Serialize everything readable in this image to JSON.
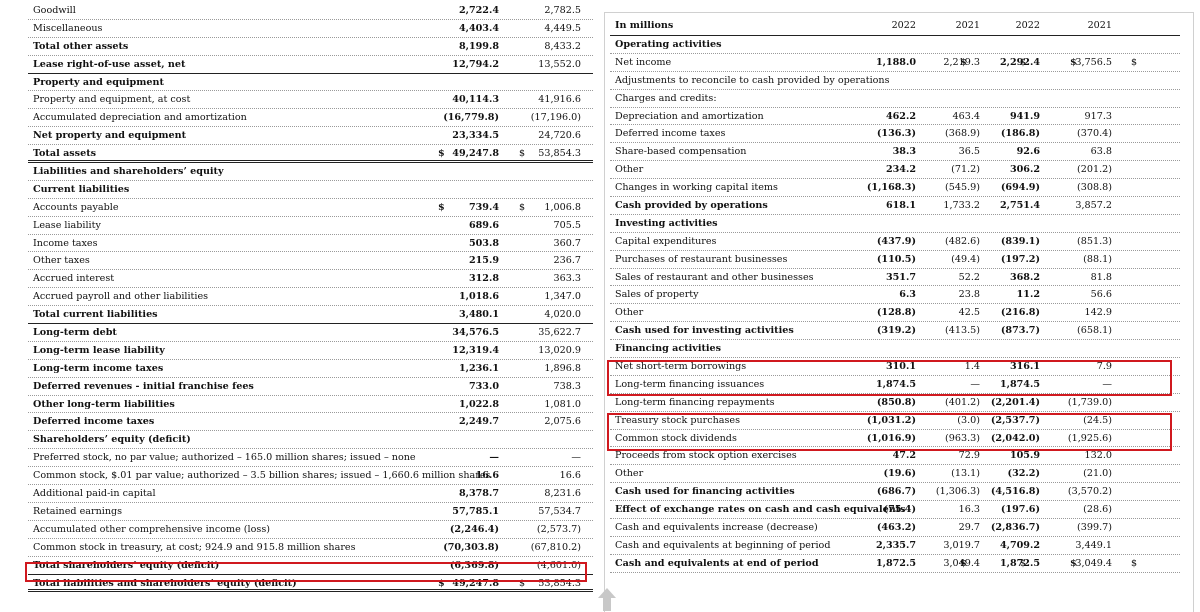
{
  "balance_sheet": {
    "rows": [
      {
        "label": "Goodwill",
        "v1": "2,722.4",
        "v2": "2,782.5",
        "style": "dotted"
      },
      {
        "label": "Miscellaneous",
        "v1": "4,403.4",
        "v2": "4,449.5",
        "style": "dotted"
      },
      {
        "label": "Total other assets",
        "v1": "8,199.8",
        "v2": "8,433.2",
        "style": "dotted",
        "bold": true
      },
      {
        "label": "Lease right-of-use asset, net",
        "v1": "12,794.2",
        "v2": "13,552.0",
        "style": "solid",
        "bold": true
      },
      {
        "label": "Property and equipment",
        "v1": "",
        "v2": "",
        "style": "dotted",
        "bold": true
      },
      {
        "label": "Property and equipment, at cost",
        "v1": "40,114.3",
        "v2": "41,916.6",
        "style": "dotted"
      },
      {
        "label": "Accumulated depreciation and amortization",
        "v1": "(16,779.8)",
        "v2": "(17,196.0)",
        "style": "dotted"
      },
      {
        "label": "Net property and equipment",
        "v1": "23,334.5",
        "v2": "24,720.6",
        "style": "dotted",
        "bold": true
      },
      {
        "label": "Total assets",
        "cur1": "$",
        "v1": "49,247.8",
        "cur2": "$",
        "v2": "53,854.3",
        "style": "double",
        "bold": true
      },
      {
        "label": "Liabilities and shareholders’ equity",
        "v1": "",
        "v2": "",
        "style": "dotted",
        "bold": true
      },
      {
        "label": "Current liabilities",
        "v1": "",
        "v2": "",
        "style": "dotted",
        "bold": true
      },
      {
        "label": "Accounts payable",
        "cur1": "$",
        "v1": "739.4",
        "cur2": "$",
        "v2": "1,006.8",
        "style": "dotted"
      },
      {
        "label": "Lease liability",
        "v1": "689.6",
        "v2": "705.5",
        "style": "dotted"
      },
      {
        "label": "Income taxes",
        "v1": "503.8",
        "v2": "360.7",
        "style": "dotted"
      },
      {
        "label": "Other taxes",
        "v1": "215.9",
        "v2": "236.7",
        "style": "dotted"
      },
      {
        "label": "Accrued interest",
        "v1": "312.8",
        "v2": "363.3",
        "style": "dotted"
      },
      {
        "label": "Accrued payroll and other liabilities",
        "v1": "1,018.6",
        "v2": "1,347.0",
        "style": "dotted"
      },
      {
        "label": "Total current liabilities",
        "v1": "3,480.1",
        "v2": "4,020.0",
        "style": "solid",
        "bold": true
      },
      {
        "label": "Long-term debt",
        "v1": "34,576.5",
        "v2": "35,622.7",
        "style": "dotted",
        "bold": true
      },
      {
        "label": "Long-term lease liability",
        "v1": "12,319.4",
        "v2": "13,020.9",
        "style": "dotted",
        "bold": true
      },
      {
        "label": "Long-term income taxes",
        "v1": "1,236.1",
        "v2": "1,896.8",
        "style": "dotted",
        "bold": true
      },
      {
        "label": "Deferred revenues - initial franchise fees",
        "v1": "733.0",
        "v2": "738.3",
        "style": "dotted",
        "bold": true
      },
      {
        "label": "Other long-term liabilities",
        "v1": "1,022.8",
        "v2": "1,081.0",
        "style": "dotted",
        "bold": true
      },
      {
        "label": "Deferred income taxes",
        "v1": "2,249.7",
        "v2": "2,075.6",
        "style": "dotted",
        "bold": true
      },
      {
        "label": "Shareholders’ equity (deficit)",
        "v1": "",
        "v2": "",
        "style": "dotted",
        "bold": true
      },
      {
        "label": "Preferred stock, no par value; authorized – 165.0 million shares; issued – none",
        "v1": "—",
        "v2": "—",
        "style": "dotted"
      },
      {
        "label": "Common stock, $.01 par value; authorized – 3.5 billion shares; issued – 1,660.6 million shares",
        "v1": "16.6",
        "v2": "16.6",
        "style": "dotted"
      },
      {
        "label": "Additional paid-in capital",
        "v1": "8,378.7",
        "v2": "8,231.6",
        "style": "dotted"
      },
      {
        "label": "Retained earnings",
        "v1": "57,785.1",
        "v2": "57,534.7",
        "style": "dotted"
      },
      {
        "label": "Accumulated other comprehensive income (loss)",
        "v1": "(2,246.4)",
        "v2": "(2,573.7)",
        "style": "dotted"
      },
      {
        "label": "Common stock in treasury, at cost; 924.9 and 915.8 million shares",
        "v1": "(70,303.8)",
        "v2": "(67,810.2)",
        "style": "dotted"
      },
      {
        "label": "Total shareholders’ equity (deficit)",
        "v1": "(6,369.8)",
        "v2": "(4,601.0)",
        "style": "solid",
        "bold": true
      },
      {
        "label": "Total liabilities and shareholders’ equity (deficit)",
        "cur1": "$",
        "v1": "49,247.8",
        "cur2": "$",
        "v2": "53,854.3",
        "style": "double",
        "bold": true
      }
    ]
  },
  "cash_flow": {
    "header": {
      "label": "In millions",
      "cols": [
        "2022",
        "2021",
        "2022",
        "2021"
      ]
    },
    "rows": [
      {
        "label": "Operating activities",
        "bold": true,
        "vals": [
          "",
          "",
          "",
          ""
        ]
      },
      {
        "label": "Net income",
        "dollar": true,
        "vals": [
          "1,188.0",
          "2,219.3",
          "2,292.4",
          "3,756.5"
        ]
      },
      {
        "label": "Adjustments to reconcile to cash provided by operations",
        "vals": [
          "",
          "",
          "",
          ""
        ]
      },
      {
        "label": "Charges and credits:",
        "vals": [
          "",
          "",
          "",
          ""
        ]
      },
      {
        "label": "Depreciation and amortization",
        "vals": [
          "462.2",
          "463.4",
          "941.9",
          "917.3"
        ]
      },
      {
        "label": "Deferred income taxes",
        "vals": [
          "(136.3)",
          "(368.9)",
          "(186.8)",
          "(370.4)"
        ]
      },
      {
        "label": "Share-based compensation",
        "vals": [
          "38.3",
          "36.5",
          "92.6",
          "63.8"
        ]
      },
      {
        "label": "Other",
        "vals": [
          "234.2",
          "(71.2)",
          "306.2",
          "(201.2)"
        ]
      },
      {
        "label": "Changes in working capital items",
        "vals": [
          "(1,168.3)",
          "(545.9)",
          "(694.9)",
          "(308.8)"
        ]
      },
      {
        "label": "Cash provided by operations",
        "bold": true,
        "vals": [
          "618.1",
          "1,733.2",
          "2,751.4",
          "3,857.2"
        ]
      },
      {
        "label": "Investing activities",
        "bold": true,
        "vals": [
          "",
          "",
          "",
          ""
        ]
      },
      {
        "label": "Capital expenditures",
        "vals": [
          "(437.9)",
          "(482.6)",
          "(839.1)",
          "(851.3)"
        ]
      },
      {
        "label": "Purchases of restaurant businesses",
        "vals": [
          "(110.5)",
          "(49.4)",
          "(197.2)",
          "(88.1)"
        ]
      },
      {
        "label": "Sales of restaurant and other businesses",
        "vals": [
          "351.7",
          "52.2",
          "368.2",
          "81.8"
        ]
      },
      {
        "label": "Sales of property",
        "vals": [
          "6.3",
          "23.8",
          "11.2",
          "56.6"
        ]
      },
      {
        "label": "Other",
        "vals": [
          "(128.8)",
          "42.5",
          "(216.8)",
          "142.9"
        ]
      },
      {
        "label": "Cash used for investing activities",
        "bold": true,
        "vals": [
          "(319.2)",
          "(413.5)",
          "(873.7)",
          "(658.1)"
        ]
      },
      {
        "label": "Financing activities",
        "bold": true,
        "vals": [
          "",
          "",
          "",
          ""
        ]
      },
      {
        "label": "Net short-term borrowings",
        "vals": [
          "310.1",
          "1.4",
          "316.1",
          "7.9"
        ]
      },
      {
        "label": "Long-term financing issuances",
        "vals": [
          "1,874.5",
          "—",
          "1,874.5",
          "—"
        ]
      },
      {
        "label": "Long-term financing repayments",
        "vals": [
          "(850.8)",
          "(401.2)",
          "(2,201.4)",
          "(1,739.0)"
        ]
      },
      {
        "label": "Treasury stock purchases",
        "vals": [
          "(1,031.2)",
          "(3.0)",
          "(2,537.7)",
          "(24.5)"
        ]
      },
      {
        "label": "Common stock dividends",
        "vals": [
          "(1,016.9)",
          "(963.3)",
          "(2,042.0)",
          "(1,925.6)"
        ]
      },
      {
        "label": "Proceeds from stock option exercises",
        "vals": [
          "47.2",
          "72.9",
          "105.9",
          "132.0"
        ]
      },
      {
        "label": "Other",
        "vals": [
          "(19.6)",
          "(13.1)",
          "(32.2)",
          "(21.0)"
        ]
      },
      {
        "label": "Cash used for financing activities",
        "bold": true,
        "vals": [
          "(686.7)",
          "(1,306.3)",
          "(4,516.8)",
          "(3,570.2)"
        ]
      },
      {
        "label": "Effect of exchange rates on cash and cash equivalents",
        "bold": true,
        "vals": [
          "(75.4)",
          "16.3",
          "(197.6)",
          "(28.6)"
        ]
      },
      {
        "label": "Cash and equivalents increase (decrease)",
        "vals": [
          "(463.2)",
          "29.7",
          "(2,836.7)",
          "(399.7)"
        ]
      },
      {
        "label": "Cash and equivalents at beginning of period",
        "vals": [
          "2,335.7",
          "3,019.7",
          "4,709.2",
          "3,449.1"
        ]
      },
      {
        "label": "Cash and equivalents at end of period",
        "bold": true,
        "dollar": true,
        "vals": [
          "1,872.5",
          "3,049.4",
          "1,872.5",
          "3,049.4"
        ]
      }
    ]
  },
  "currency_symbol": "$",
  "highlight_color": "#d0191f",
  "scroll_icon": "scroll-up-arrow-icon"
}
